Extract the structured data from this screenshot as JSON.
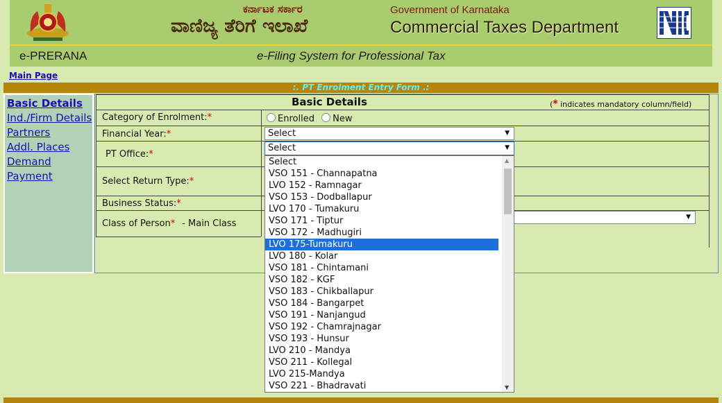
{
  "header": {
    "kannada_top": "ಕರ್ನಾಟಕ ಸರ್ಕಾರ",
    "kannada_main": "ವಾಣಿಜ್ಯ ತೆರಿಗೆ ಇಲಾಖೆ",
    "government": "Government  of  Karnataka",
    "department": "Commercial Taxes Department",
    "app_name": "e-PRERANA",
    "system_title": "e-Filing System for Professional Tax"
  },
  "main_page_link": "Main Page",
  "form_title": ":. PT Enrolment Entry Form .:",
  "nav": [
    "Basic Details",
    "Ind./Firm Details",
    "Partners",
    "Addl. Places",
    "Demand",
    "Payment"
  ],
  "form": {
    "section_title": "Basic Details",
    "mandatory_prefix": "(",
    "mandatory_star": "*",
    "mandatory_note": " indicates mandatory column/field)",
    "category_label": "Category of Enrolment:",
    "radio_enrolled": "Enrolled",
    "radio_new": "New",
    "financial_year_label": "Financial Year:",
    "financial_year_value": "Select",
    "pt_office_label": "PT Office:",
    "pt_office_value": "Select",
    "return_type_label": "Select Return Type:",
    "business_status_label": "Business Status:",
    "class_of_person_label": "Class of Person",
    "main_class_label": "-    Main Class",
    "star": "*"
  },
  "pt_office_options": [
    "Select",
    "VSO 151 - Channapatna",
    "LVO 152 - Ramnagar",
    "VSO 153 - Dodballapur",
    "LVO 170 - Tumakuru",
    "VSO 171 - Tiptur",
    "VSO 172 - Madhugiri",
    "LVO 175-Tumakuru",
    "LVO 180 - Kolar",
    "VSO 181 - Chintamani",
    "VSO 182 - KGF",
    "VSO 183 - Chikballapur",
    "VSO 184 - Bangarpet",
    "VSO 191 - Nanjangud",
    "VSO 192 - Chamrajnagar",
    "VSO 193 - Hunsur",
    "LVO 210 - Mandya",
    "VSO 211 - Kollegal",
    "LVO 215-Mandya",
    "VSO 221 - Bhadravati"
  ],
  "highlighted_option": "LVO 175-Tumakuru",
  "colors": {
    "header_green": "#a9cc6e",
    "page_bg": "#d9eab1",
    "form_bar": "#b5860c",
    "highlight": "#1e6fd9",
    "link": "#1a0fb5"
  }
}
